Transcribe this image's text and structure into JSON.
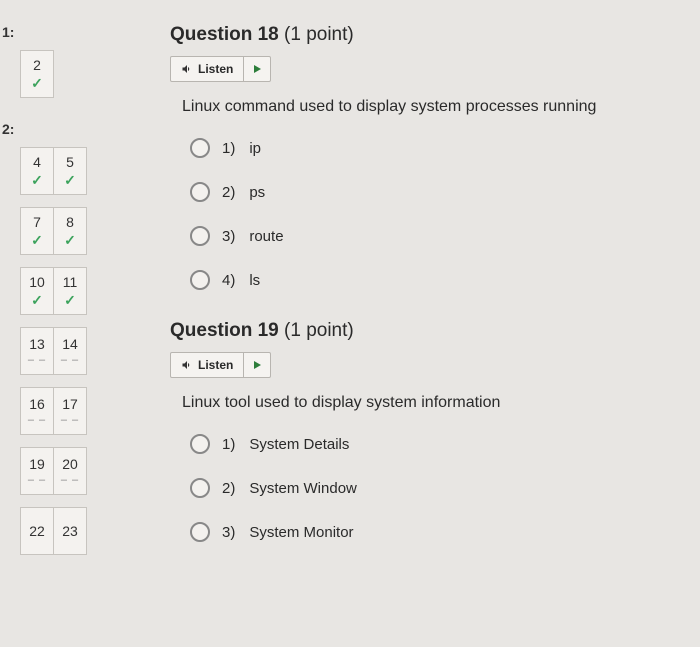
{
  "sidebar": {
    "attempt1": {
      "label": "1:",
      "items": [
        {
          "num": "2",
          "status": "check"
        }
      ]
    },
    "attempt2": {
      "label": "2:",
      "rows": [
        [
          {
            "num": "4",
            "status": "check"
          },
          {
            "num": "5",
            "status": "check"
          }
        ],
        [
          {
            "num": "7",
            "status": "check"
          },
          {
            "num": "8",
            "status": "check"
          }
        ],
        [
          {
            "num": "10",
            "status": "check"
          },
          {
            "num": "11",
            "status": "check"
          }
        ],
        [
          {
            "num": "13",
            "status": "dash"
          },
          {
            "num": "14",
            "status": "dash"
          }
        ],
        [
          {
            "num": "16",
            "status": "dash"
          },
          {
            "num": "17",
            "status": "dash"
          }
        ],
        [
          {
            "num": "19",
            "status": "dash"
          },
          {
            "num": "20",
            "status": "dash"
          }
        ],
        [
          {
            "num": "22",
            "status": ""
          },
          {
            "num": "23",
            "status": ""
          }
        ]
      ]
    }
  },
  "questions": [
    {
      "title": "Question 18",
      "points": "(1 point)",
      "listen": "Listen",
      "prompt": "Linux command used to display system processes running",
      "options": [
        {
          "num": "1)",
          "text": "ip"
        },
        {
          "num": "2)",
          "text": "ps"
        },
        {
          "num": "3)",
          "text": "route"
        },
        {
          "num": "4)",
          "text": "ls"
        }
      ]
    },
    {
      "title": "Question 19",
      "points": "(1 point)",
      "listen": "Listen",
      "prompt": "Linux tool used to display system information",
      "options": [
        {
          "num": "1)",
          "text": "System Details"
        },
        {
          "num": "2)",
          "text": "System Window"
        },
        {
          "num": "3)",
          "text": "System Monitor"
        }
      ]
    }
  ]
}
